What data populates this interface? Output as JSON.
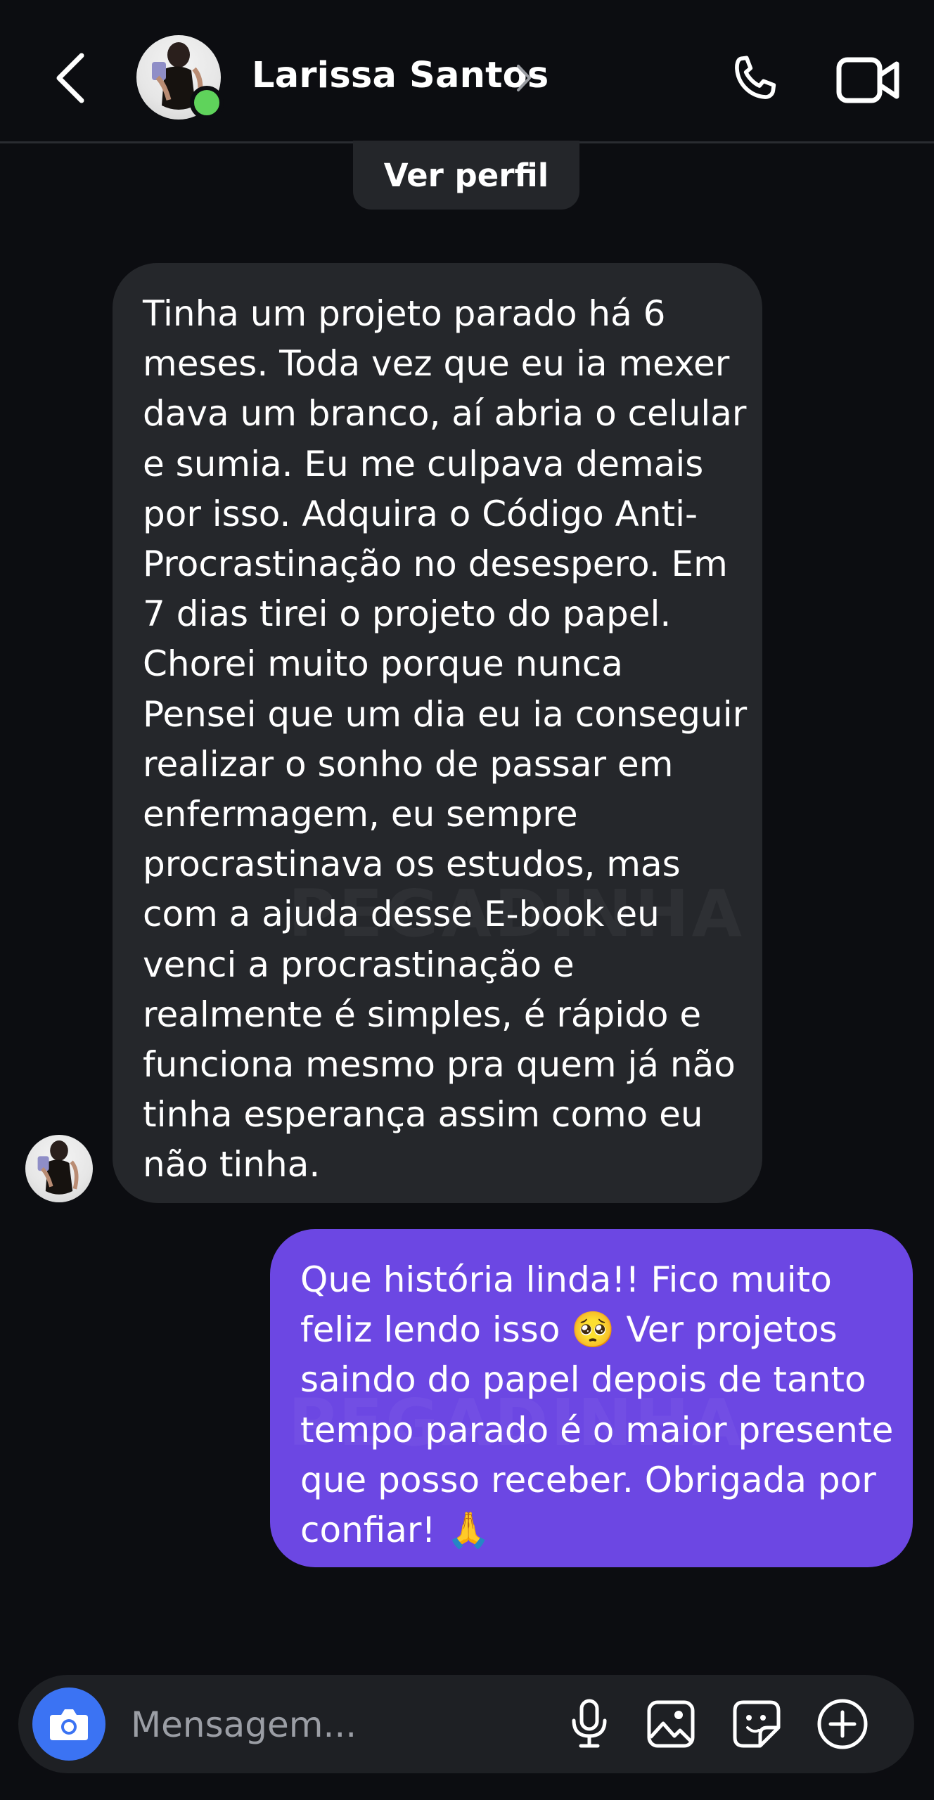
{
  "header": {
    "contact_name": "Larissa Santos",
    "online": true,
    "icons": {
      "back": "chevron-left-icon",
      "name_chevron": "chevron-right-icon",
      "call": "phone-icon",
      "video": "video-camera-icon"
    }
  },
  "profile_button_label": "Ver perfil",
  "messages": {
    "received": {
      "lines": [
        "Tinha um projeto parado há 6",
        "meses. Toda vez que eu ia mexer",
        "dava um branco, aí abria o celular",
        "e sumia. Eu me culpava demais",
        "por isso. Adquira o Código Anti-",
        "Procrastinação no desespero. Em",
        "7 dias tirei o projeto do papel.",
        "Chorei muito porque nunca",
        "Pensei que um dia eu ia conseguir",
        "realizar o sonho de passar em",
        "enfermagem, eu sempre",
        "procrastinava os estudos, mas",
        "com a ajuda desse E-book eu",
        "venci a procrastinação e",
        "realmente é simples, é rápido e",
        "funciona mesmo pra quem já não",
        "tinha esperança assim como eu",
        "não tinha."
      ]
    },
    "sent": {
      "lines": [
        "Que história linda!! Fico muito",
        "feliz lendo isso 🥺 Ver projetos",
        "saindo do papel depois de tanto",
        "tempo parado é o maior presente",
        "que posso receber. Obrigada por",
        "confiar! 🙏"
      ]
    },
    "watermark": "PEGADINHA"
  },
  "composer": {
    "placeholder": "Mensagem...",
    "icons": {
      "camera": "camera-icon",
      "mic": "microphone-icon",
      "gallery": "image-icon",
      "sticker": "sticker-icon",
      "plus": "plus-circle-icon"
    }
  },
  "colors": {
    "background": "#0c0d11",
    "received_bubble": "#25272b",
    "sent_bubble": "#6c47e3",
    "camera_button": "#3b73f3",
    "online_dot": "#5fd35b"
  }
}
